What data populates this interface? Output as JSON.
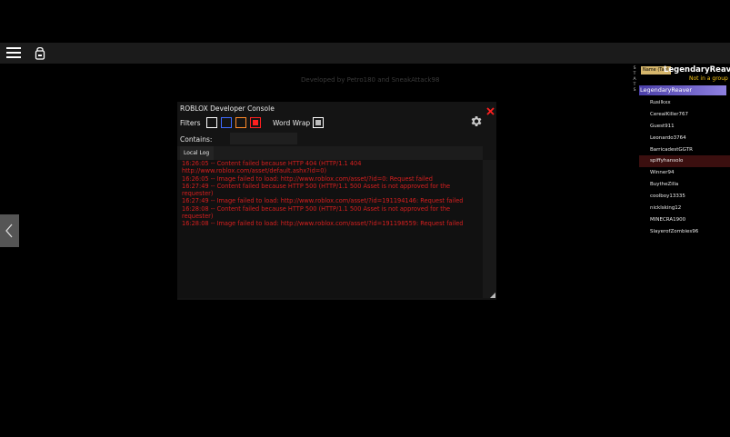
{
  "topbar": {
    "menu_icon": "hamburger-menu-icon",
    "backpack_icon": "backpack-icon"
  },
  "credits": "Developed by Petro180 and SneakAttack98",
  "side_tab": {
    "icon": "chevron-left-icon"
  },
  "console": {
    "title": "ROBLOX Developer Console",
    "filters_label": "Filters",
    "filters": [
      {
        "name": "output",
        "color": "#ffffff",
        "checked": false
      },
      {
        "name": "info",
        "color": "#3f6bff",
        "checked": false
      },
      {
        "name": "warning",
        "color": "#ff8a2a",
        "checked": false
      },
      {
        "name": "error",
        "color": "#ff2020",
        "checked": true
      }
    ],
    "word_wrap_label": "Word Wrap",
    "word_wrap_checked": true,
    "contains_label": "Contains:",
    "contains_value": "",
    "tabs": [
      {
        "label": "Local Log",
        "active": true
      }
    ],
    "log_color": "#d81f1f",
    "log_lines": [
      "16:26:05 -- Content failed because HTTP 404 (HTTP/1.1 404",
      "http://www.roblox.com/asset/default.ashx?id=0)",
      "16:26:05 -- Image failed to load: http://www.roblox.com/asset/?id=0: Request failed",
      "16:27:49 -- Content failed because HTTP 500 (HTTP/1.1 500 Asset is not approved for the",
      "requester)",
      "16:27:49 -- Image failed to load: http://www.roblox.com/asset/?id=191194146: Request failed",
      "16:28:08 -- Content failed because HTTP 500 (HTTP/1.1 500 Asset is not approved for the",
      "requester)",
      "16:28:08 -- Image failed to load: http://www.roblox.com/asset/?id=191198559: Request failed"
    ],
    "close_icon": "close-icon",
    "settings_icon": "gear-icon"
  },
  "leaderboard": {
    "name_tag": "Name (Tag)",
    "player_name": "LegendaryReaver",
    "player_group": "Not in a group",
    "stats_label": "STATS",
    "self_row": "LegendaryReaver",
    "players": [
      {
        "name": "Rusilkxx",
        "highlighted": false
      },
      {
        "name": "CerealKiller767",
        "highlighted": false
      },
      {
        "name": "Guest911",
        "highlighted": false
      },
      {
        "name": "Leonardo3764",
        "highlighted": false
      },
      {
        "name": "BarricadestGGTR",
        "highlighted": false
      },
      {
        "name": "spiffyhansolo",
        "highlighted": true
      },
      {
        "name": "Winner94",
        "highlighted": false
      },
      {
        "name": "BuytheZilla",
        "highlighted": false
      },
      {
        "name": "coolboy13335",
        "highlighted": false
      },
      {
        "name": "nicklsking12",
        "highlighted": false
      },
      {
        "name": "MINECRA1900",
        "highlighted": false
      },
      {
        "name": "SlayerofZombies96",
        "highlighted": false
      }
    ]
  }
}
